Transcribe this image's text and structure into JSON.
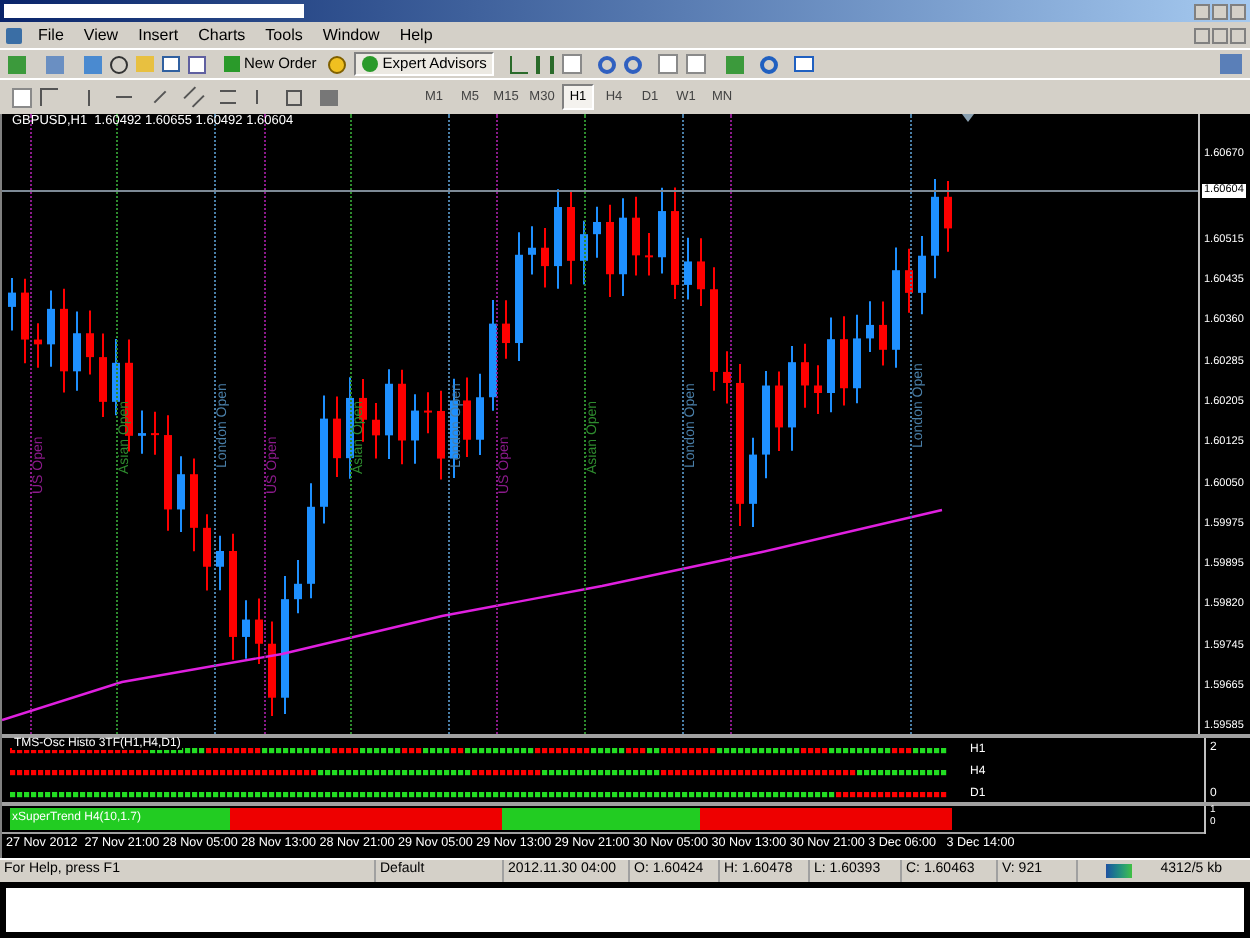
{
  "menu": [
    "File",
    "View",
    "Insert",
    "Charts",
    "Tools",
    "Window",
    "Help"
  ],
  "toolbar": {
    "new_order": "New Order",
    "expert_advisors": {
      "label": "Expert Advisors",
      "pressed": true
    }
  },
  "timeframes": [
    {
      "label": "M1",
      "selected": false
    },
    {
      "label": "M5",
      "selected": false
    },
    {
      "label": "M15",
      "selected": false
    },
    {
      "label": "M30",
      "selected": false
    },
    {
      "label": "H1",
      "selected": true
    },
    {
      "label": "H4",
      "selected": false
    },
    {
      "label": "D1",
      "selected": false
    },
    {
      "label": "W1",
      "selected": false
    },
    {
      "label": "MN",
      "selected": false
    }
  ],
  "chart": {
    "header": "GBPUSD,H1  1.60492 1.60655 1.60492 1.60604",
    "price_labels": [
      {
        "text": "1.60670",
        "current": false
      },
      {
        "text": "1.60604",
        "current": true
      },
      {
        "text": "1.60515",
        "current": false
      },
      {
        "text": "1.60435",
        "current": false
      },
      {
        "text": "1.60360",
        "current": false
      },
      {
        "text": "1.60285",
        "current": false
      },
      {
        "text": "1.60205",
        "current": false
      },
      {
        "text": "1.60125",
        "current": false
      },
      {
        "text": "1.60050",
        "current": false
      },
      {
        "text": "1.59975",
        "current": false
      },
      {
        "text": "1.59895",
        "current": false
      },
      {
        "text": "1.59820",
        "current": false
      },
      {
        "text": "1.59745",
        "current": false
      },
      {
        "text": "1.59665",
        "current": false
      },
      {
        "text": "1.59585",
        "current": false
      }
    ],
    "sessions": [
      {
        "label": "US Open",
        "color": "#8b1a8b"
      },
      {
        "label": "Asian Open",
        "color": "#2e8b2e"
      },
      {
        "label": "London Open",
        "color": "#4a7fa8"
      },
      {
        "label": "US Open",
        "color": "#8b1a8b"
      },
      {
        "label": "Asian Open",
        "color": "#2e8b2e"
      },
      {
        "label": "London Open",
        "color": "#4a7fa8"
      },
      {
        "label": "US Open",
        "color": "#8b1a8b"
      },
      {
        "label": "Asian Open",
        "color": "#2e8b2e"
      },
      {
        "label": "London Open",
        "color": "#4a7fa8"
      },
      {
        "label": "London Open",
        "color": "#4a7fa8"
      }
    ],
    "oscillator": {
      "title": "TMS-Osc Histo 3TF(H1,H4,D1)",
      "rows": [
        "H1",
        "H4",
        "D1"
      ],
      "scale": [
        "2",
        "0"
      ]
    },
    "supertrend": {
      "title": "xSuperTrend H4(10,1.7)",
      "scale": [
        "1",
        "0"
      ]
    },
    "time_labels": [
      "27 Nov 2012",
      "27 Nov 21:00",
      "28 Nov 05:00",
      "28 Nov 13:00",
      "28 Nov 21:00",
      "29 Nov 05:00",
      "29 Nov 13:00",
      "29 Nov 21:00",
      "30 Nov 05:00",
      "30 Nov 13:00",
      "30 Nov 21:00",
      "3 Dec 06:00",
      "3 Dec 14:00"
    ]
  },
  "status_bar": [
    "For Help, press F1",
    "Default",
    "2012.11.30 04:00",
    "O: 1.60424",
    "H: 1.60478",
    "L: 1.60393",
    "C: 1.60463",
    "V: 921",
    "4312/5 kb"
  ]
}
